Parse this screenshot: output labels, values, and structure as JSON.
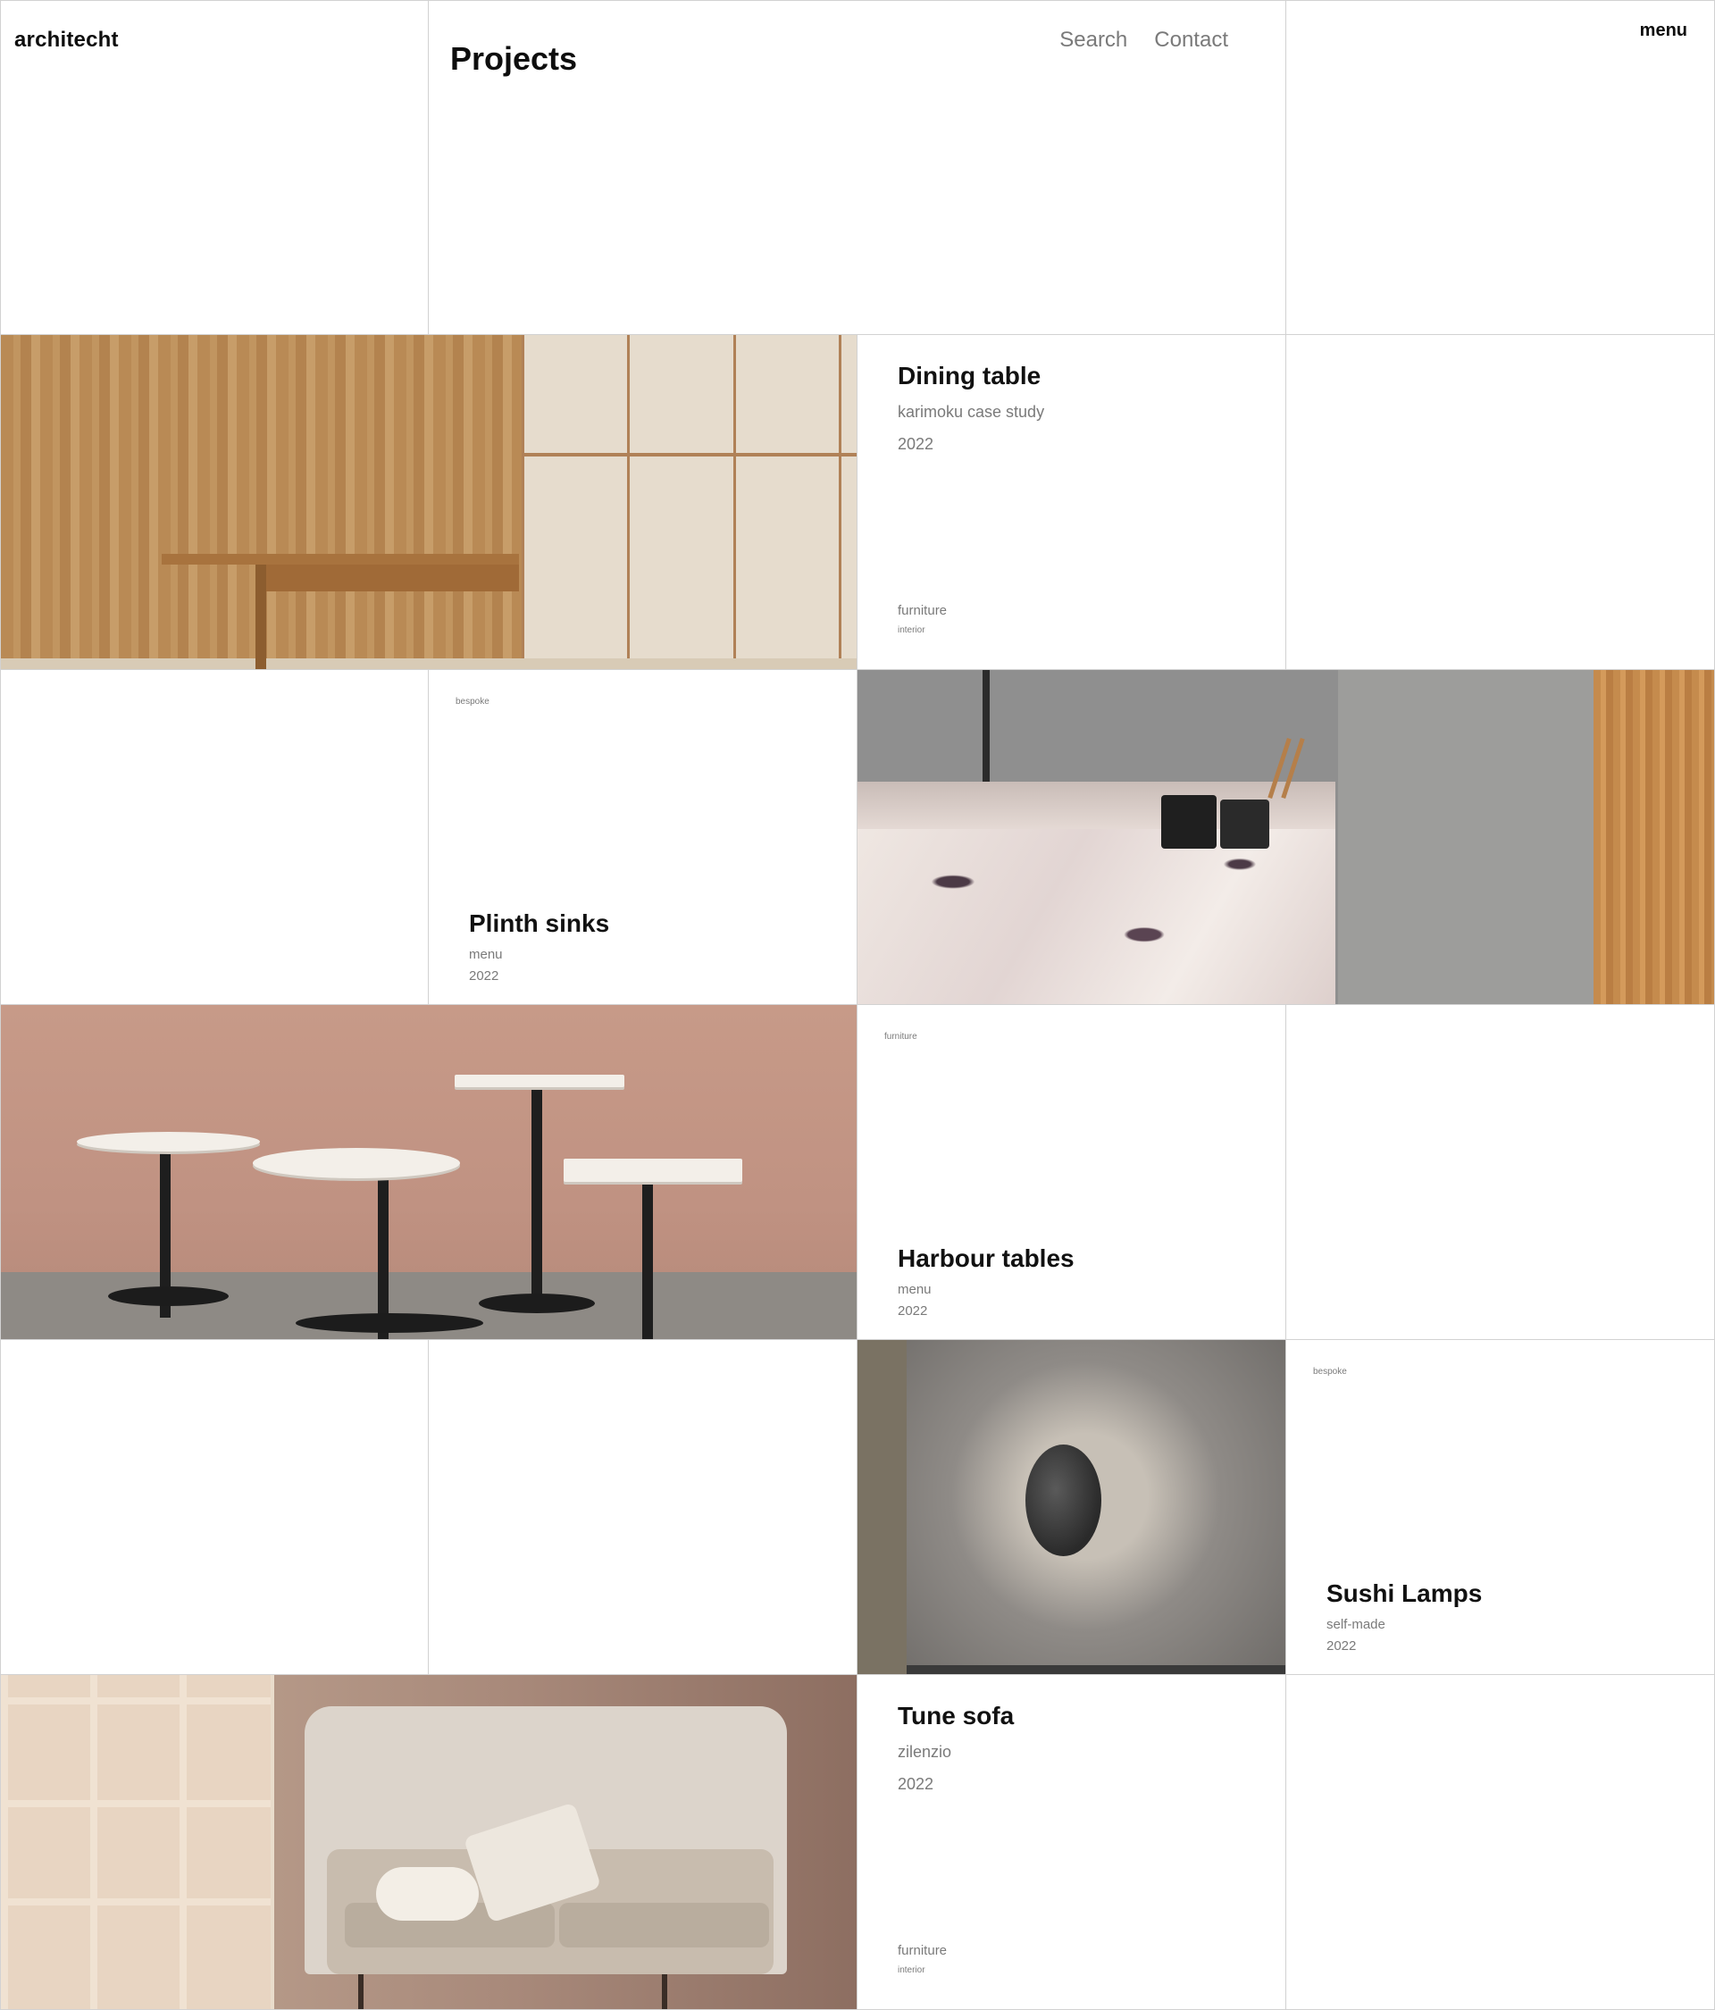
{
  "brand": {
    "name": "architecht"
  },
  "page": {
    "title": "Projects"
  },
  "nav": {
    "search": "Search",
    "contact": "Contact",
    "menu": "menu"
  },
  "projects": [
    {
      "title": "Dining table",
      "subtitle": "karimoku case study",
      "year": "2022",
      "category": "furniture",
      "tag": "interior",
      "image": "dining-table-photo"
    },
    {
      "title": "Plinth sinks",
      "subtitle": "menu",
      "year": "2022",
      "tag": "bespoke",
      "image": "plinth-sinks-photo"
    },
    {
      "title": "Harbour tables",
      "subtitle": "menu",
      "year": "2022",
      "tag": "furniture",
      "image": "harbour-tables-photo"
    },
    {
      "title": "Sushi Lamps",
      "subtitle": "self-made",
      "year": "2022",
      "tag": "bespoke",
      "image": "sushi-lamp-photo"
    },
    {
      "title": "Tune sofa",
      "subtitle": "zilenzio",
      "year": "2022",
      "category": "furniture",
      "tag": "interior",
      "image": "tune-sofa-photo"
    }
  ],
  "colors": {
    "text": "#0e0e0e",
    "muted": "#7a7a7a",
    "gridline": "#d2d2d2",
    "background": "#ffffff"
  }
}
